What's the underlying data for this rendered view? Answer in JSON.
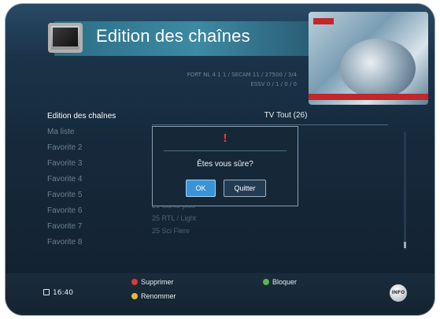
{
  "header": {
    "title": "Edition des chaînes"
  },
  "info": {
    "line1": "FORT NL 4 1 1 / SECAM 11 / 27500 / 3/4",
    "line2": "ESSV 0 / 1 / 0 / 0"
  },
  "menu": {
    "items": [
      "Edition des chaînes",
      "Ma liste",
      "Favorite 2",
      "Favorite 3",
      "Favorite 4",
      "Favorite 5",
      "Favorite 6",
      "Favorite 7",
      "Favorite 8"
    ]
  },
  "list": {
    "header": "TV Tout (26)",
    "rows": [
      "21  Canal plus",
      "25  RTL / Light",
      "25  Sci Fiere"
    ]
  },
  "dialog": {
    "warning_symbol": "!",
    "message": "Êtes vous sûre?",
    "ok_label": "OK",
    "quit_label": "Quitter"
  },
  "footer": {
    "time": "16:40",
    "delete_label": "Supprimer",
    "rename_label": "Renommer",
    "lock_label": "Bloquer",
    "info_label": "INFO",
    "colors": {
      "red": "#d93a34",
      "yellow": "#e9b73a",
      "green": "#62b446"
    }
  }
}
